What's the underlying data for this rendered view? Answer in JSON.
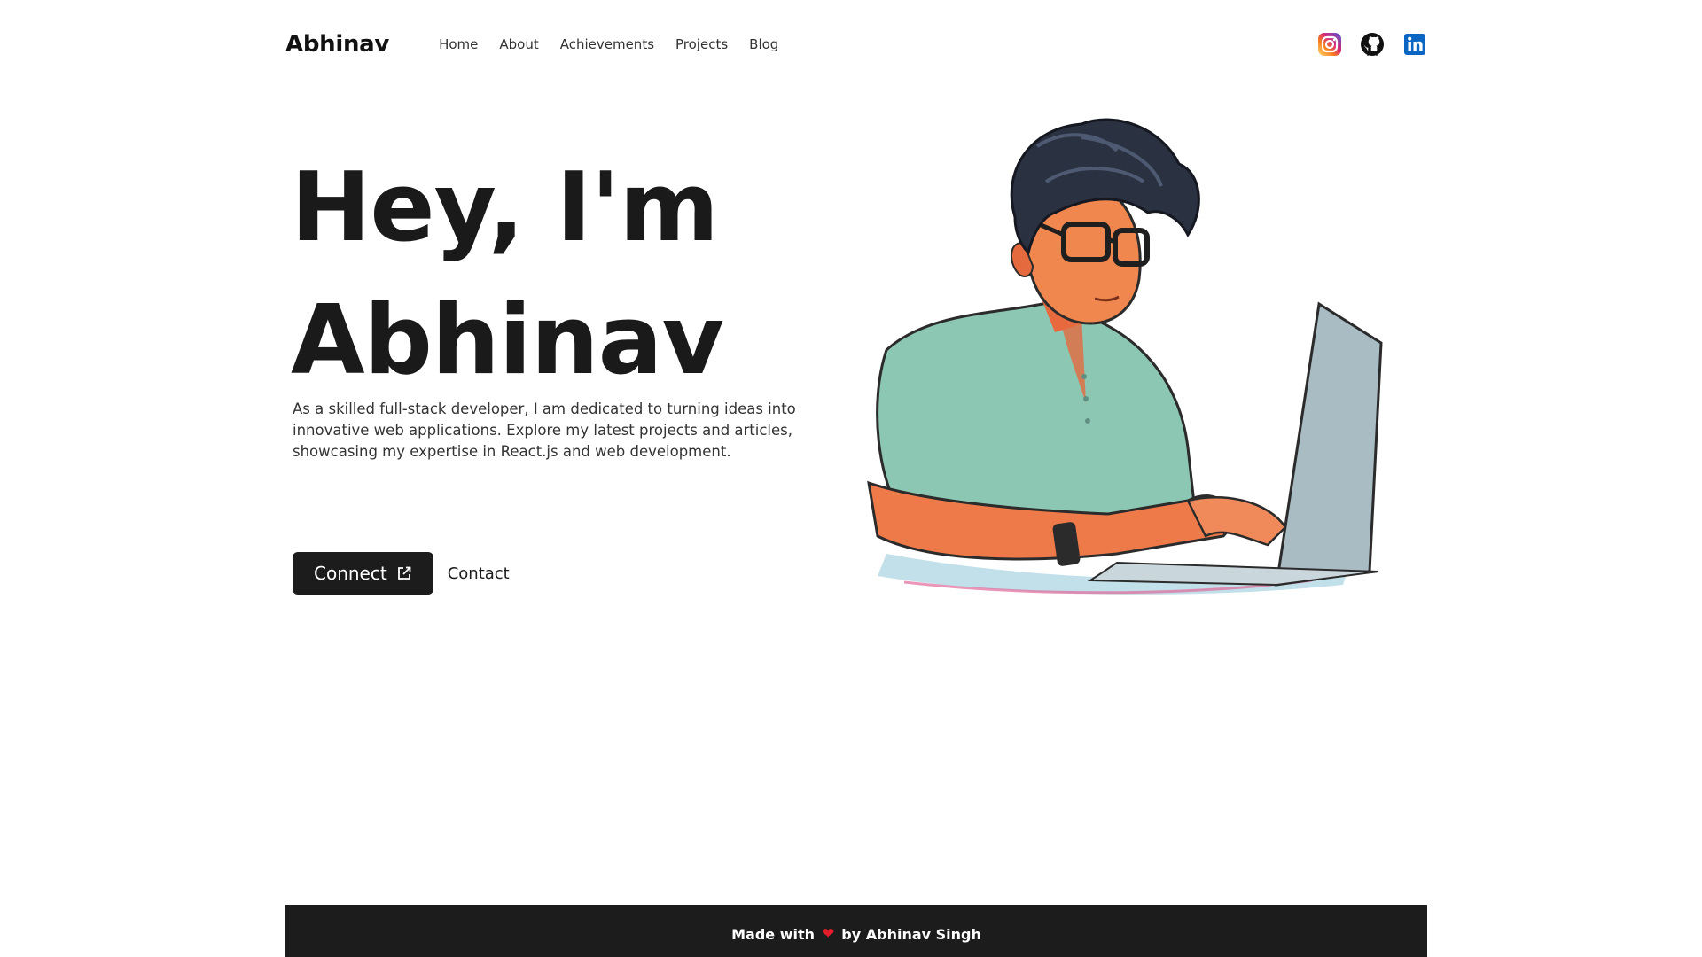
{
  "header": {
    "brand": "Abhinav",
    "nav": {
      "home": "Home",
      "about": "About",
      "achievements": "Achievements",
      "projects": "Projects",
      "blog": "Blog"
    },
    "socials": [
      "instagram-icon",
      "github-icon",
      "linkedin-icon"
    ]
  },
  "hero": {
    "title_line1": "Hey, I'm",
    "title_line2": "Abhinav",
    "description": "As a skilled full-stack developer, I am dedicated to turning ideas into innovative web applications. Explore my latest projects and articles, showcasing my expertise in React.js and web development.",
    "connect_label": "Connect",
    "contact_label": "Contact",
    "illustration": "developer-illustration"
  },
  "footer": {
    "made_with": "Made with",
    "by": "by Abhinav Singh",
    "heart_icon": "heart-icon"
  },
  "colors": {
    "text": "#1c1c1c",
    "button_bg": "#1c1c1c",
    "footer_bg": "#1c1c1c",
    "heart": "#e11d2a",
    "linkedin": "#0a66c2"
  }
}
